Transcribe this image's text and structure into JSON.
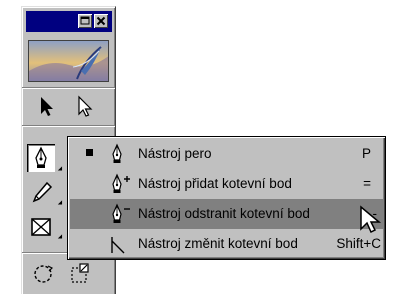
{
  "palette": {
    "window_buttons": [
      "minimize-maximize",
      "close"
    ],
    "tools": [
      "selection-arrow",
      "subselection-arrow",
      "pen",
      "pencil",
      "rectangle-frame",
      "rotate",
      "transform"
    ]
  },
  "menu": {
    "items": [
      {
        "label": "Nástroj pero",
        "shortcut": "P",
        "checked": true,
        "highlighted": false,
        "icon": "pen-icon"
      },
      {
        "label": "Nástroj přidat kotevní bod",
        "shortcut": "=",
        "checked": false,
        "highlighted": false,
        "icon": "pen-add-icon"
      },
      {
        "label": "Nástroj odstranit kotevní bod",
        "shortcut": "-",
        "checked": false,
        "highlighted": true,
        "icon": "pen-delete-icon"
      },
      {
        "label": "Nástroj změnit kotevní bod",
        "shortcut": "Shift+C",
        "checked": false,
        "highlighted": false,
        "icon": "convert-anchor-icon"
      }
    ]
  },
  "colors": {
    "face": "#c0c0c0",
    "titlebar": "#000080",
    "highlight": "#808080"
  }
}
